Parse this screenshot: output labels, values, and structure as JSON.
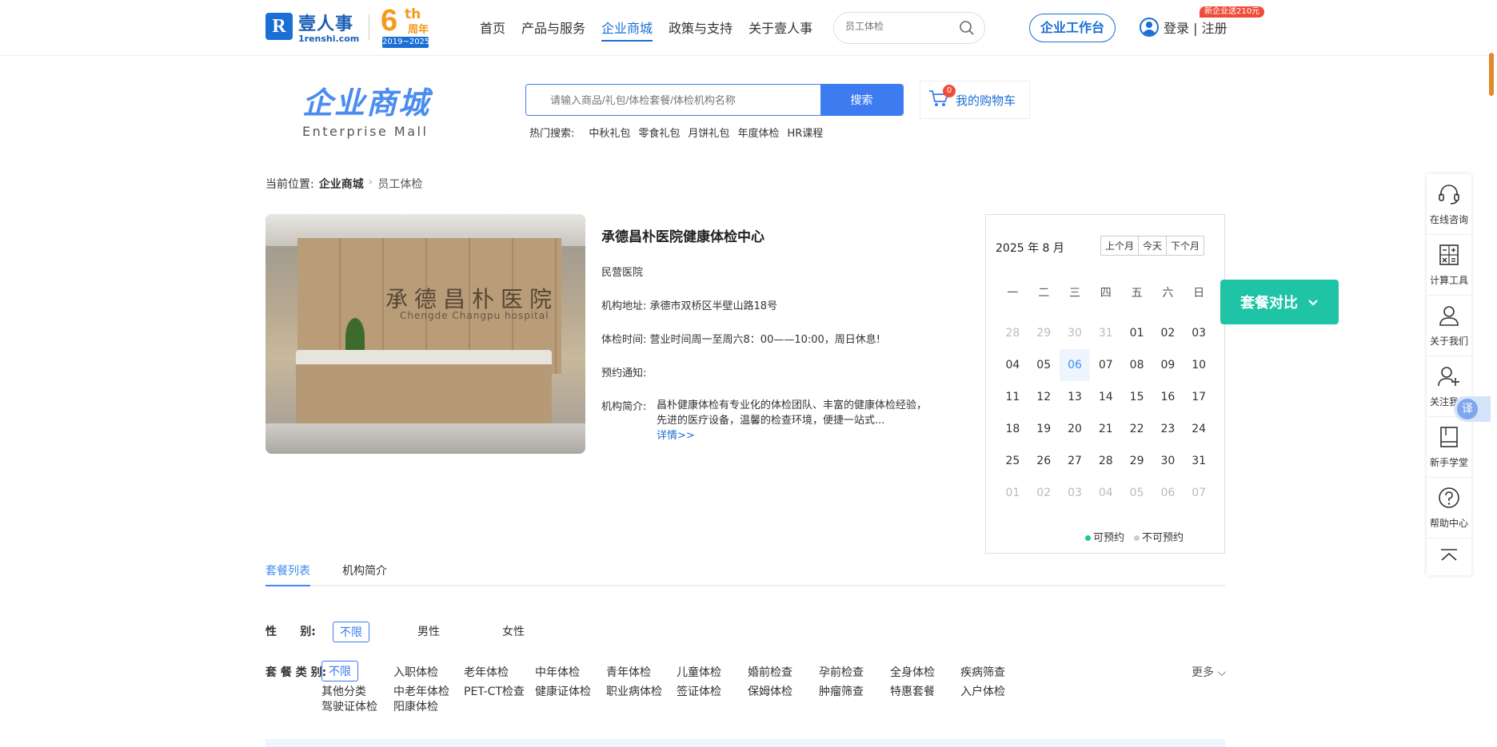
{
  "brand": {
    "cn": "壹人事",
    "en": "1renshi.com",
    "anniv_num": "6",
    "anniv_th": "th",
    "anniv_cn": "周年",
    "anniv_years": "2019~2025"
  },
  "nav": [
    "首页",
    "产品与服务",
    "企业商城",
    "政策与支持",
    "关于壹人事"
  ],
  "nav_active": "企业商城",
  "top_search": {
    "placeholder": "员工体检"
  },
  "workbench_label": "企业工作台",
  "login_label": "登录 | 注册",
  "promo_badge": "新企业送210元",
  "mall": {
    "title_cn": "企业商城",
    "title_en": "Enterprise  Mall"
  },
  "mall_search": {
    "placeholder": "请输入商品/礼包/体检套餐/体检机构名称",
    "button": "搜索"
  },
  "hot_search": {
    "label": "热门搜索:",
    "items": [
      "中秋礼包",
      "零食礼包",
      "月饼礼包",
      "年度体检",
      "HR课程"
    ]
  },
  "cart": {
    "label": "我的购物车",
    "count": "0"
  },
  "breadcrumb": {
    "prefix": "当前位置:",
    "current": "企业商城",
    "last": "员工体检"
  },
  "photo": {
    "sign_cn": "承德昌朴医院",
    "sign_en": "Chengde Changpu hospital"
  },
  "institution": {
    "name": "承德昌朴医院健康体检中心",
    "type": "民营医院",
    "address_label": "机构地址:",
    "address": "承德市双桥区半壁山路18号",
    "hours_label": "体检时间:",
    "hours": "营业时间周一至周六8：00——10:00，周日休息!",
    "notice_label": "预约通知:",
    "notice": "",
    "intro_label": "机构简介:",
    "intro": "昌朴健康体检有专业化的体检团队、丰富的健康体检经验，先进的医疗设备，温馨的检查环境，便捷一站式...",
    "more": "详情>>"
  },
  "calendar": {
    "month_label": "2025 年 8 月",
    "buttons": [
      "上个月",
      "今天",
      "下个月"
    ],
    "weekdays": [
      "一",
      "二",
      "三",
      "四",
      "五",
      "六",
      "日"
    ],
    "days": [
      {
        "d": "28",
        "dim": true
      },
      {
        "d": "29",
        "dim": true
      },
      {
        "d": "30",
        "dim": true
      },
      {
        "d": "31",
        "dim": true
      },
      {
        "d": "01"
      },
      {
        "d": "02"
      },
      {
        "d": "03"
      },
      {
        "d": "04"
      },
      {
        "d": "05"
      },
      {
        "d": "06",
        "today": true
      },
      {
        "d": "07"
      },
      {
        "d": "08"
      },
      {
        "d": "09"
      },
      {
        "d": "10"
      },
      {
        "d": "11"
      },
      {
        "d": "12"
      },
      {
        "d": "13"
      },
      {
        "d": "14"
      },
      {
        "d": "15"
      },
      {
        "d": "16"
      },
      {
        "d": "17"
      },
      {
        "d": "18"
      },
      {
        "d": "19"
      },
      {
        "d": "20"
      },
      {
        "d": "21"
      },
      {
        "d": "22"
      },
      {
        "d": "23"
      },
      {
        "d": "24"
      },
      {
        "d": "25"
      },
      {
        "d": "26"
      },
      {
        "d": "27"
      },
      {
        "d": "28"
      },
      {
        "d": "29"
      },
      {
        "d": "30"
      },
      {
        "d": "31"
      },
      {
        "d": "01",
        "dim": true
      },
      {
        "d": "02",
        "dim": true
      },
      {
        "d": "03",
        "dim": true
      },
      {
        "d": "04",
        "dim": true
      },
      {
        "d": "05",
        "dim": true
      },
      {
        "d": "06",
        "dim": true
      },
      {
        "d": "07",
        "dim": true
      }
    ],
    "legend_available": "可预约",
    "legend_unavailable": "不可预约",
    "available_color": "#1fc4a7",
    "unavailable_color": "#cccccc"
  },
  "compare_button": "套餐对比",
  "sidebar": [
    {
      "label": "在线咨询",
      "icon": "headset-icon"
    },
    {
      "label": "计算工具",
      "icon": "calculator-icon"
    },
    {
      "label": "关于我们",
      "icon": "user-icon"
    },
    {
      "label": "关注我们",
      "icon": "user-add-icon"
    },
    {
      "label": "新手学堂",
      "icon": "book-icon"
    },
    {
      "label": "帮助中心",
      "icon": "help-icon"
    }
  ],
  "translate_label": "译",
  "tabs": [
    "套餐列表",
    "机构简介"
  ],
  "filters": {
    "gender_label": "性      别:",
    "gender_options": [
      "不限",
      "男性",
      "女性"
    ],
    "category_label": "套 餐 类 别:",
    "category_options": [
      "不限",
      "入职体检",
      "老年体检",
      "中年体检",
      "青年体检",
      "儿童体检",
      "婚前检查",
      "孕前检查",
      "全身体检",
      "疾病筛查",
      "其他分类",
      "中老年体检",
      "PET-CT检查",
      "健康证体检",
      "职业病体检",
      "签证体检",
      "保姆体检",
      "肿瘤筛查",
      "特惠套餐",
      "入户体检",
      "驾驶证体检",
      "阳康体检"
    ],
    "more_label": "更多"
  },
  "colors": {
    "primary": "#1a6fd4",
    "accent": "#3c7cf0",
    "teal": "#1fc4a7",
    "orange": "#f39a1e",
    "red": "#f04c3b"
  }
}
